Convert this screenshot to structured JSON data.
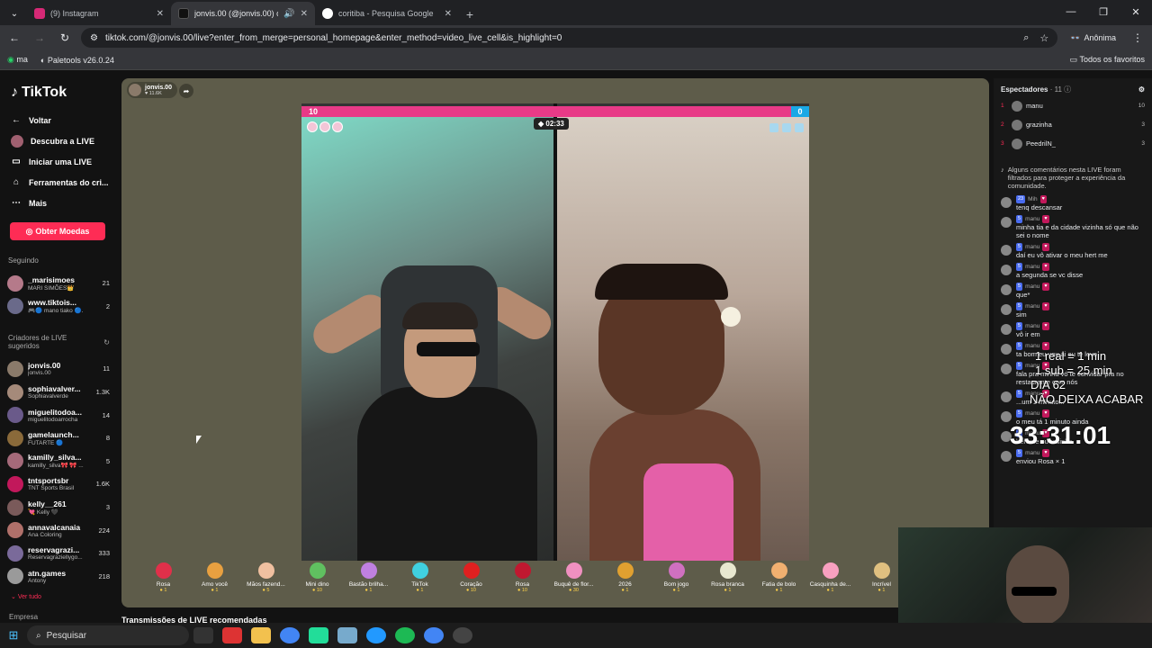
{
  "tabs": [
    {
      "title": "(9) Instagram",
      "color": "#d62976"
    },
    {
      "title": "jonvis.00 (@jonvis.00) com...",
      "color": "#111111",
      "active": true
    },
    {
      "title": "coritiba - Pesquisa Google",
      "color": "#4285f4"
    }
  ],
  "address": {
    "url": "tiktok.com/@jonvis.00/live?enter_from_merge=personal_homepage&enter_method=video_live_cell&is_highlight=0",
    "incognito_label": "Anônima"
  },
  "bookmarks": {
    "item1": "ma",
    "item2": "Paletools v26.0.24",
    "all": "Todos os favoritos"
  },
  "leftnav": {
    "logo": "TikTok",
    "back": "Voltar",
    "items": [
      "Descubra a LIVE",
      "Iniciar uma LIVE",
      "Ferramentas do cri...",
      "Mais"
    ],
    "coins_button": "Obter Moedas",
    "following_header": "Seguindo",
    "following": [
      {
        "name": "_marisimoes",
        "sub": "MARI SIMÕES👑",
        "count": "21",
        "color": "#b57a8a"
      },
      {
        "name": "www.tiktois...",
        "sub": "🎮🔵 mano tiako 🔵...",
        "count": "2",
        "color": "#6a6a8a"
      }
    ],
    "suggested_header": "Criadores de LIVE sugeridos",
    "suggested": [
      {
        "name": "jonvis.00",
        "sub": "jonvis.00",
        "count": "11",
        "color": "#8a7a6a"
      },
      {
        "name": "sophiavalver...",
        "sub": "Sophiavalverde",
        "count": "1.3K",
        "color": "#a58a7a"
      },
      {
        "name": "miguelitodoa...",
        "sub": "miguelitodoarrocha",
        "count": "14",
        "color": "#6a5a8a"
      },
      {
        "name": "gamelaunch...",
        "sub": "FUTARTE 🔵",
        "count": "8",
        "color": "#8a6a3a"
      },
      {
        "name": "kamilly_silva...",
        "sub": "kamilly_silva🎀 🎀 ...",
        "count": "5",
        "color": "#a56a7a"
      },
      {
        "name": "tntsportsbr",
        "sub": "TNT Sports Brasil",
        "count": "1.6K",
        "color": "#c2185b"
      },
      {
        "name": "kelly__261",
        "sub": "💘 Kelly 🖤",
        "count": "3",
        "color": "#7a5a5a"
      },
      {
        "name": "annavalcanaia",
        "sub": "Ana Coloring",
        "count": "224",
        "color": "#b0706a"
      },
      {
        "name": "reservagrazi...",
        "sub": "Reservagraziellygo...",
        "count": "333",
        "color": "#7a6a9a"
      },
      {
        "name": "atn.games",
        "sub": "Antony",
        "count": "218",
        "color": "#9a9a9a"
      }
    ],
    "see_all": "Ver tudo",
    "company": "Empresa"
  },
  "stage": {
    "host_name": "jonvis.00",
    "host_likes": "11.6K",
    "score_left": "10",
    "score_right": "0",
    "timer": "02:33"
  },
  "gifts": [
    {
      "name": "Rosa",
      "price": "1",
      "color": "#e0304a"
    },
    {
      "name": "Amo você",
      "price": "1",
      "color": "#e8a040"
    },
    {
      "name": "Mãos fazend...",
      "price": "5",
      "color": "#f0c0a0"
    },
    {
      "name": "Mini dino",
      "price": "10",
      "color": "#60c060"
    },
    {
      "name": "Bastão brilha...",
      "price": "1",
      "color": "#c080e0"
    },
    {
      "name": "TikTok",
      "price": "1",
      "color": "#40d0e0"
    },
    {
      "name": "Coração",
      "price": "10",
      "color": "#e02020"
    },
    {
      "name": "Rosa",
      "price": "10",
      "color": "#c01830"
    },
    {
      "name": "Buquê de flor...",
      "price": "30",
      "color": "#f090c0"
    },
    {
      "name": "2026",
      "price": "1",
      "color": "#e0a030"
    },
    {
      "name": "Bom jogo",
      "price": "1",
      "color": "#d070c0"
    },
    {
      "name": "Rosa branca",
      "price": "1",
      "color": "#e8e8d0"
    },
    {
      "name": "Fatia de bolo",
      "price": "1",
      "color": "#f0b070"
    },
    {
      "name": "Casquinha de...",
      "price": "1",
      "color": "#f8a0c0"
    },
    {
      "name": "Incrível",
      "price": "1",
      "color": "#e0c080"
    }
  ],
  "recommended": "Transmissões de LIVE recomendadas",
  "viewers": {
    "title": "Espectadores",
    "count": "· 11",
    "list": [
      {
        "rank": "1",
        "name": "manu",
        "score": "10"
      },
      {
        "rank": "2",
        "name": "grazinha",
        "score": "3"
      },
      {
        "rank": "3",
        "name": "PeedrilN_",
        "score": "3"
      }
    ]
  },
  "chat": {
    "system": "Alguns comentários nesta LIVE foram filtrados para proteger a experiência da comunidade.",
    "messages": [
      {
        "user": "Mih",
        "level": "23",
        "text": "tenq descansar"
      },
      {
        "user": "manu",
        "level": "5",
        "text": "minha tia e da cidade vizinha só que não sei o nome"
      },
      {
        "user": "manu",
        "level": "5",
        "text": "daí eu vô ativar o meu hert me"
      },
      {
        "user": "manu",
        "level": "5",
        "text": "a segunda se vc disse"
      },
      {
        "user": "manu",
        "level": "5",
        "text": "que*"
      },
      {
        "user": "manu",
        "level": "5",
        "text": "sim"
      },
      {
        "user": "manu",
        "level": "5",
        "text": "vô ir em"
      },
      {
        "user": "manu",
        "level": "5",
        "text": "ta bom eu vou ai eu te levo"
      },
      {
        "user": "manu",
        "level": "5",
        "text": "fala pra minha vó te convidar pra no restaurante com nós"
      },
      {
        "user": "manu",
        "level": "5",
        "text": "...um 1 minuto..."
      },
      {
        "user": "manu",
        "level": "5",
        "text": "o meu tá 1 minuto ainda"
      },
      {
        "user": "manu",
        "level": "5",
        "text": "hert me ou rosinha"
      },
      {
        "user": "manu",
        "level": "5",
        "text": "enviou Rosa × 1"
      }
    ]
  },
  "overlay": {
    "line1": "1 real = 1 min",
    "line2": "1 sub = 25 min",
    "line3": "DIA 62",
    "line4": "NÃO DEIXA ACABAR",
    "timer": "33:31:01"
  },
  "taskbar": {
    "search": "Pesquisar"
  }
}
